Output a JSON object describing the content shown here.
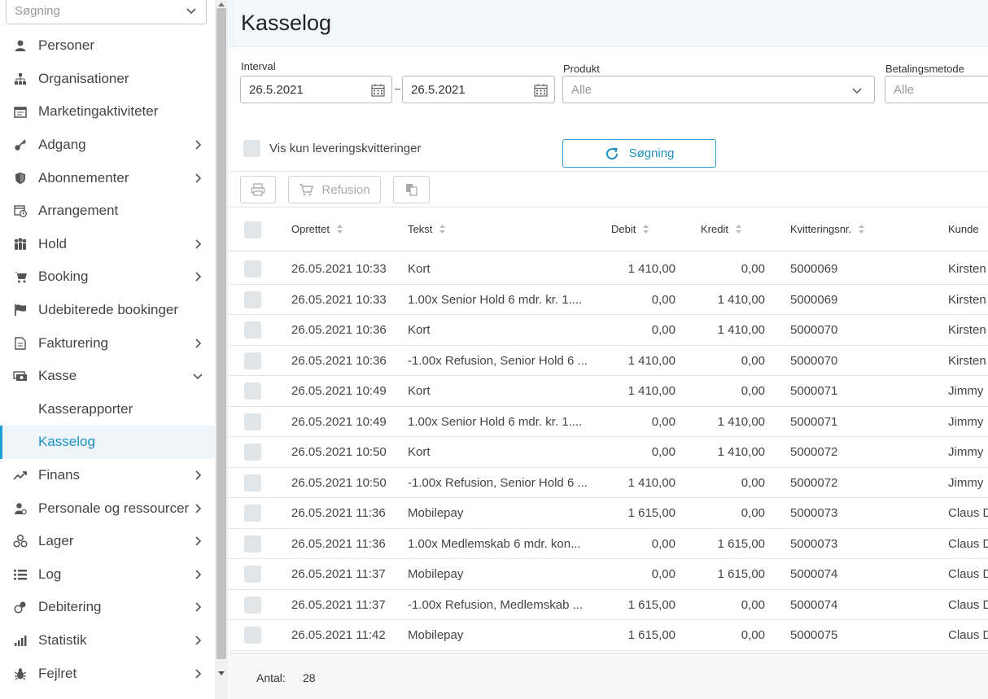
{
  "sidebar": {
    "search_placeholder": "Søgning",
    "items": [
      {
        "label": "Personer",
        "icon": "person-icon",
        "has_arrow": false
      },
      {
        "label": "Organisationer",
        "icon": "sitemap-icon",
        "has_arrow": false
      },
      {
        "label": "Marketingaktiviteter",
        "icon": "calendar-list-icon",
        "has_arrow": false
      },
      {
        "label": "Adgang",
        "icon": "key-icon",
        "has_arrow": true
      },
      {
        "label": "Abonnementer",
        "icon": "shield-icon",
        "has_arrow": true
      },
      {
        "label": "Arrangement",
        "icon": "calendar-clock-icon",
        "has_arrow": false
      },
      {
        "label": "Hold",
        "icon": "group-icon",
        "has_arrow": true
      },
      {
        "label": "Booking",
        "icon": "cart-icon",
        "has_arrow": true
      },
      {
        "label": "Udebiterede bookinger",
        "icon": "flag-icon",
        "has_arrow": false
      },
      {
        "label": "Fakturering",
        "icon": "invoice-icon",
        "has_arrow": true
      },
      {
        "label": "Kasse",
        "icon": "cash-icon",
        "has_arrow": true,
        "expanded": true
      },
      {
        "label": "Kasserapporter",
        "sub": true
      },
      {
        "label": "Kasselog",
        "sub": true,
        "active": true
      },
      {
        "label": "Finans",
        "icon": "trend-icon",
        "has_arrow": true
      },
      {
        "label": "Personale og ressourcer",
        "icon": "staff-icon",
        "has_arrow": true
      },
      {
        "label": "Lager",
        "icon": "boxes-icon",
        "has_arrow": true
      },
      {
        "label": "Log",
        "icon": "list-icon",
        "has_arrow": true
      },
      {
        "label": "Debitering",
        "icon": "coins-icon",
        "has_arrow": true
      },
      {
        "label": "Statistik",
        "icon": "bar-chart-icon",
        "has_arrow": true
      },
      {
        "label": "Fejlret",
        "icon": "bug-icon",
        "has_arrow": true
      }
    ]
  },
  "header": {
    "title": "Kasselog"
  },
  "filters": {
    "interval_label": "Interval",
    "date_from": "26.5.2021",
    "date_to": "26.5.2021",
    "product_label": "Produkt",
    "product_value": "Alle",
    "payment_label": "Betalingsmetode",
    "payment_value": "Alle",
    "only_delivery_label": "Vis kun leveringskvitteringer",
    "search_button": "Søgning"
  },
  "toolbar": {
    "refund_label": "Refusion"
  },
  "table": {
    "columns": [
      "Oprettet",
      "Tekst",
      "Debit",
      "Kredit",
      "Kvitteringsnr.",
      "Kunde"
    ],
    "rows": [
      [
        "26.05.2021 10:33",
        "Kort",
        "1 410,00",
        "0,00",
        "5000069",
        "Kirsten"
      ],
      [
        "26.05.2021 10:33",
        "1.00x Senior Hold 6 mdr. kr. 1....",
        "0,00",
        "1 410,00",
        "5000069",
        "Kirsten"
      ],
      [
        "26.05.2021 10:36",
        "Kort",
        "0,00",
        "1 410,00",
        "5000070",
        "Kirsten"
      ],
      [
        "26.05.2021 10:36",
        "-1.00x Refusion, Senior Hold 6 ...",
        "1 410,00",
        "0,00",
        "5000070",
        "Kirsten"
      ],
      [
        "26.05.2021 10:49",
        "Kort",
        "1 410,00",
        "0,00",
        "5000071",
        "Jimmy"
      ],
      [
        "26.05.2021 10:49",
        "1.00x Senior Hold 6 mdr. kr. 1....",
        "0,00",
        "1 410,00",
        "5000071",
        "Jimmy"
      ],
      [
        "26.05.2021 10:50",
        "Kort",
        "0,00",
        "1 410,00",
        "5000072",
        "Jimmy"
      ],
      [
        "26.05.2021 10:50",
        "-1.00x Refusion, Senior Hold 6 ...",
        "1 410,00",
        "0,00",
        "5000072",
        "Jimmy"
      ],
      [
        "26.05.2021 11:36",
        "Mobilepay",
        "1 615,00",
        "0,00",
        "5000073",
        "Claus D"
      ],
      [
        "26.05.2021 11:36",
        "1.00x Medlemskab 6 mdr. kon...",
        "0,00",
        "1 615,00",
        "5000073",
        "Claus D"
      ],
      [
        "26.05.2021 11:37",
        "Mobilepay",
        "0,00",
        "1 615,00",
        "5000074",
        "Claus D"
      ],
      [
        "26.05.2021 11:37",
        "-1.00x Refusion, Medlemskab ...",
        "1 615,00",
        "0,00",
        "5000074",
        "Claus D"
      ],
      [
        "26.05.2021 11:42",
        "Mobilepay",
        "1 615,00",
        "0,00",
        "5000075",
        "Claus D"
      ]
    ]
  },
  "footer": {
    "count_label": "Antal:",
    "count_value": "28"
  },
  "colors": {
    "accent": "#1a8fc4",
    "header_bg": "#f1f8fb",
    "active_bg": "#eef6fb"
  }
}
